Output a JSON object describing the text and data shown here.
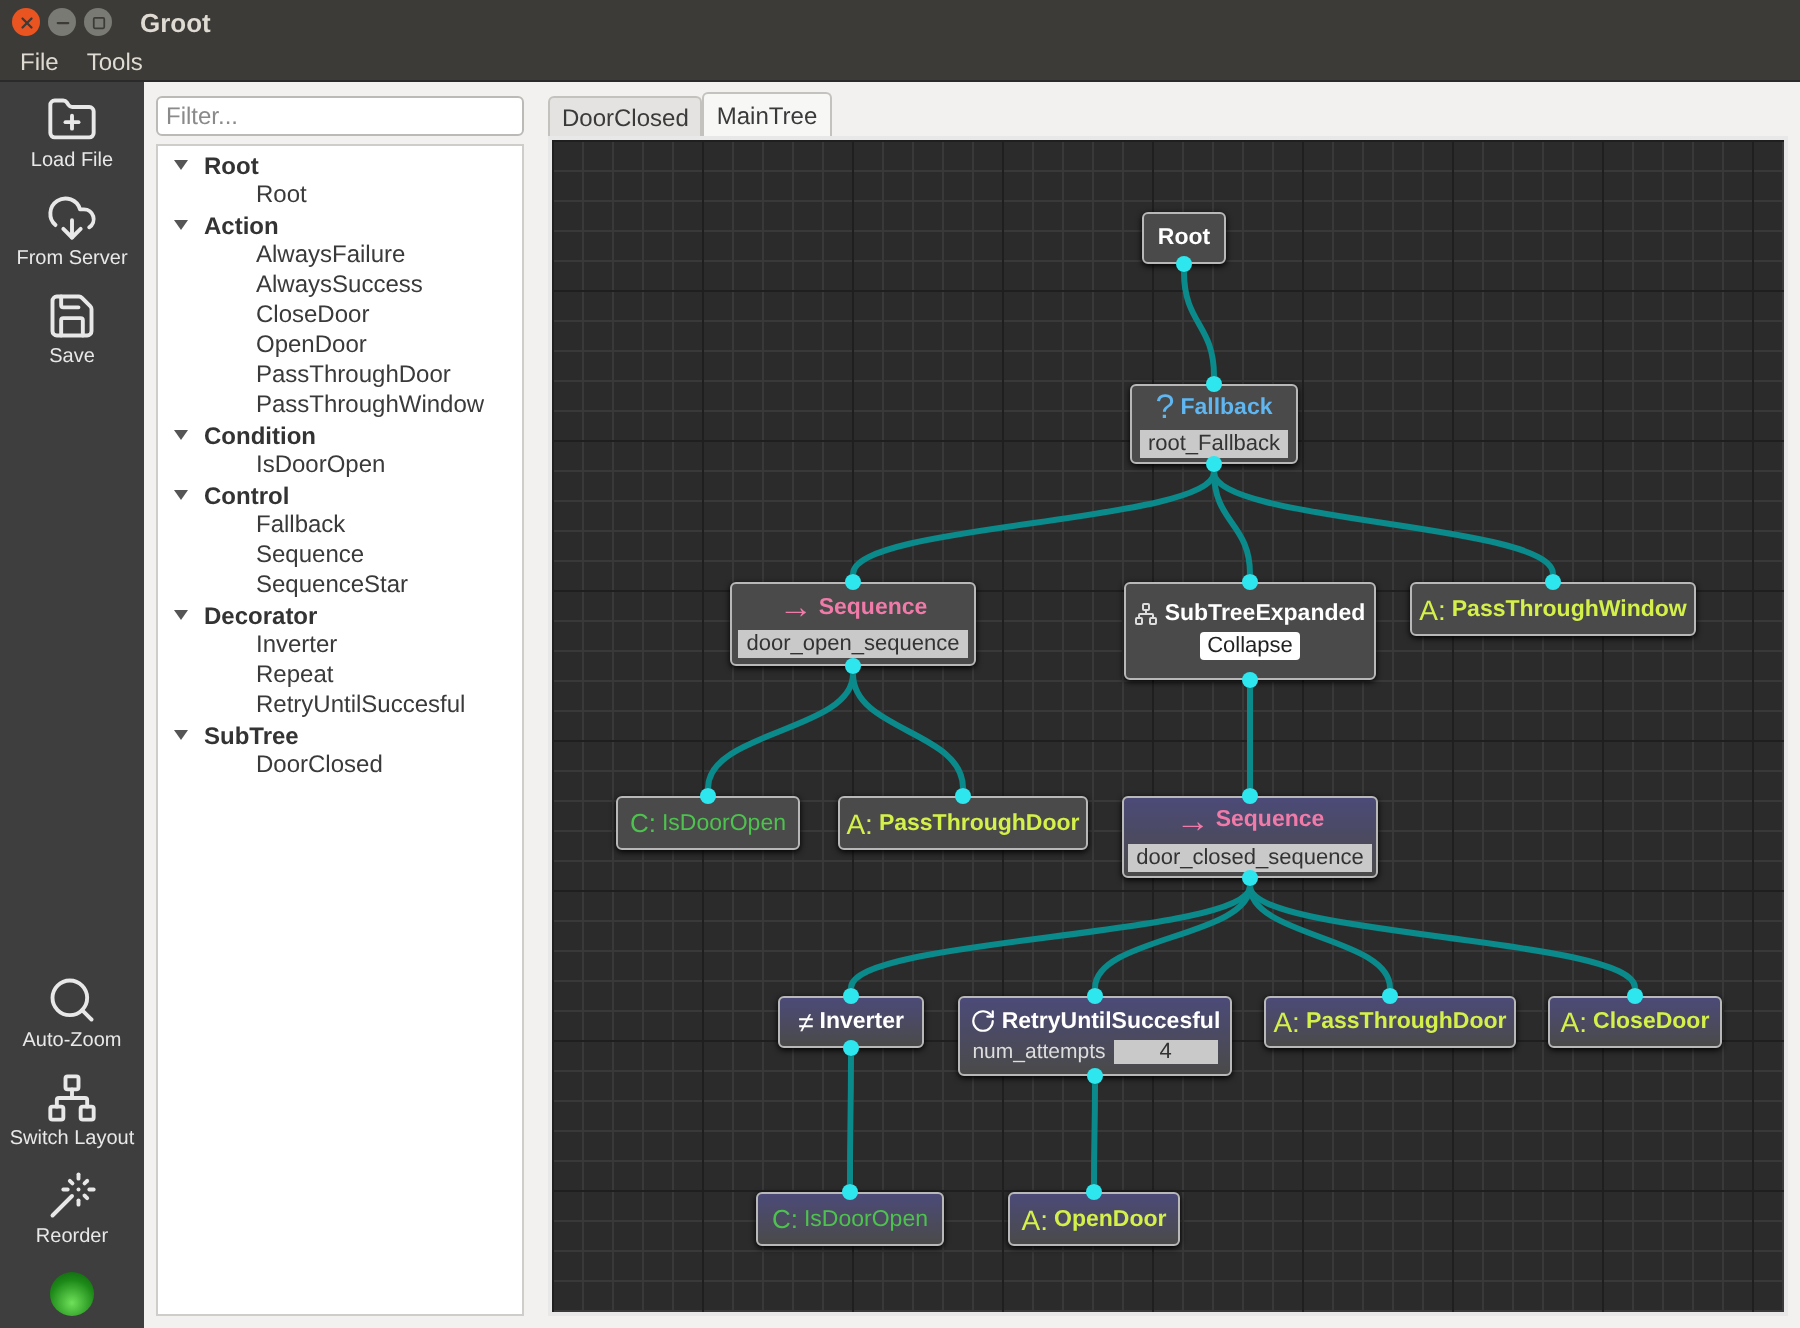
{
  "window": {
    "title": "Groot"
  },
  "menu": [
    "File",
    "Tools"
  ],
  "toolbar": {
    "top": [
      {
        "kind": "load",
        "label": "Load File"
      },
      {
        "kind": "server",
        "label": "From Server"
      },
      {
        "kind": "save",
        "label": "Save"
      }
    ],
    "bottom": [
      {
        "kind": "zoom",
        "label": "Auto-Zoom"
      },
      {
        "kind": "layout",
        "label": "Switch Layout"
      },
      {
        "kind": "reorder",
        "label": "Reorder"
      }
    ]
  },
  "palette": {
    "filter": {
      "placeholder": "Filter..."
    },
    "groups": [
      {
        "label": "Root",
        "expanded": true,
        "children": [
          {
            "label": "Root"
          }
        ]
      },
      {
        "label": "Action",
        "expanded": true,
        "children": [
          {
            "label": "AlwaysFailure"
          },
          {
            "label": "AlwaysSuccess"
          },
          {
            "label": "CloseDoor"
          },
          {
            "label": "OpenDoor"
          },
          {
            "label": "PassThroughDoor"
          },
          {
            "label": "PassThroughWindow"
          }
        ]
      },
      {
        "label": "Condition",
        "expanded": true,
        "children": [
          {
            "label": "IsDoorOpen"
          }
        ]
      },
      {
        "label": "Control",
        "expanded": true,
        "children": [
          {
            "label": "Fallback"
          },
          {
            "label": "Sequence"
          },
          {
            "label": "SequenceStar"
          }
        ]
      },
      {
        "label": "Decorator",
        "expanded": true,
        "children": [
          {
            "label": "Inverter"
          },
          {
            "label": "Repeat"
          },
          {
            "label": "RetryUntilSuccesful"
          }
        ]
      },
      {
        "label": "SubTree",
        "expanded": true,
        "children": [
          {
            "label": "DoorClosed"
          }
        ]
      }
    ]
  },
  "tabs": [
    {
      "label": "DoorClosed",
      "selected": false
    },
    {
      "label": "MainTree",
      "selected": true
    }
  ],
  "tree": {
    "kind": "root",
    "title": "Root",
    "children": [
      {
        "kind": "control",
        "symbol": "?",
        "title": "Fallback",
        "color": "#5fb6f0",
        "name_field": "root_Fallback",
        "children": [
          {
            "kind": "control",
            "symbol": "→",
            "title": "Sequence",
            "color": "#f07aa8",
            "name_field": "door_open_sequence",
            "children": [
              {
                "kind": "condition",
                "symbol": "C:",
                "title": "IsDoorOpen",
                "color": "#4ec24e"
              },
              {
                "kind": "action",
                "symbol": "A:",
                "title": "PassThroughDoor",
                "color": "#d4f04a"
              }
            ]
          },
          {
            "kind": "subtree",
            "title": "SubTreeExpanded",
            "button": "Collapse",
            "children": [
              {
                "kind": "control",
                "symbol": "→",
                "title": "Sequence",
                "color": "#f07aa8",
                "name_field": "door_closed_sequence",
                "children": [
                  {
                    "kind": "decorator",
                    "symbol": "≠",
                    "title": "Inverter",
                    "children": [
                      {
                        "kind": "condition",
                        "symbol": "C:",
                        "title": "IsDoorOpen",
                        "color": "#4ec24e"
                      }
                    ]
                  },
                  {
                    "kind": "retry",
                    "title": "RetryUntilSuccesful",
                    "params": [
                      {
                        "key": "num_attempts",
                        "value": "4"
                      }
                    ],
                    "children": [
                      {
                        "kind": "action",
                        "symbol": "A:",
                        "title": "OpenDoor",
                        "color": "#d4f04a"
                      }
                    ]
                  },
                  {
                    "kind": "action",
                    "symbol": "A:",
                    "title": "PassThroughDoor",
                    "color": "#d4f04a"
                  },
                  {
                    "kind": "action",
                    "symbol": "A:",
                    "title": "CloseDoor",
                    "color": "#d4f04a"
                  }
                ]
              }
            ]
          },
          {
            "kind": "action",
            "symbol": "A:",
            "title": "PassThroughWindow",
            "color": "#d4f04a"
          }
        ]
      }
    ]
  }
}
